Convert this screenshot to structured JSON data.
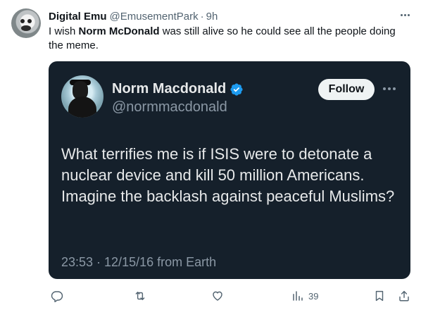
{
  "post": {
    "author_name": "Digital Emu",
    "author_handle": "@EmusementPark",
    "separator": "·",
    "time_ago": "9h",
    "text_before": "I wish ",
    "text_bold": "Norm McDonald",
    "text_after": " was still alive so he could see all the people doing the meme."
  },
  "quoted": {
    "name": "Norm Macdonald",
    "handle": "@normmacdonald",
    "follow_label": "Follow",
    "text": "What terrifies me is if ISIS were to detonate a nuclear device and kill 50 million Americans. Imagine the backlash against peaceful Muslims?",
    "meta": "23:53 · 12/15/16 from Earth"
  },
  "actions": {
    "reply_icon": "reply-icon",
    "retweet_icon": "retweet-icon",
    "like_icon": "like-icon",
    "views_icon": "views-icon",
    "views_count": "39",
    "bookmark_icon": "bookmark-icon",
    "share_icon": "share-icon"
  },
  "colors": {
    "card_bg": "#15202b",
    "verified": "#1d9bf0",
    "muted": "#536471"
  }
}
